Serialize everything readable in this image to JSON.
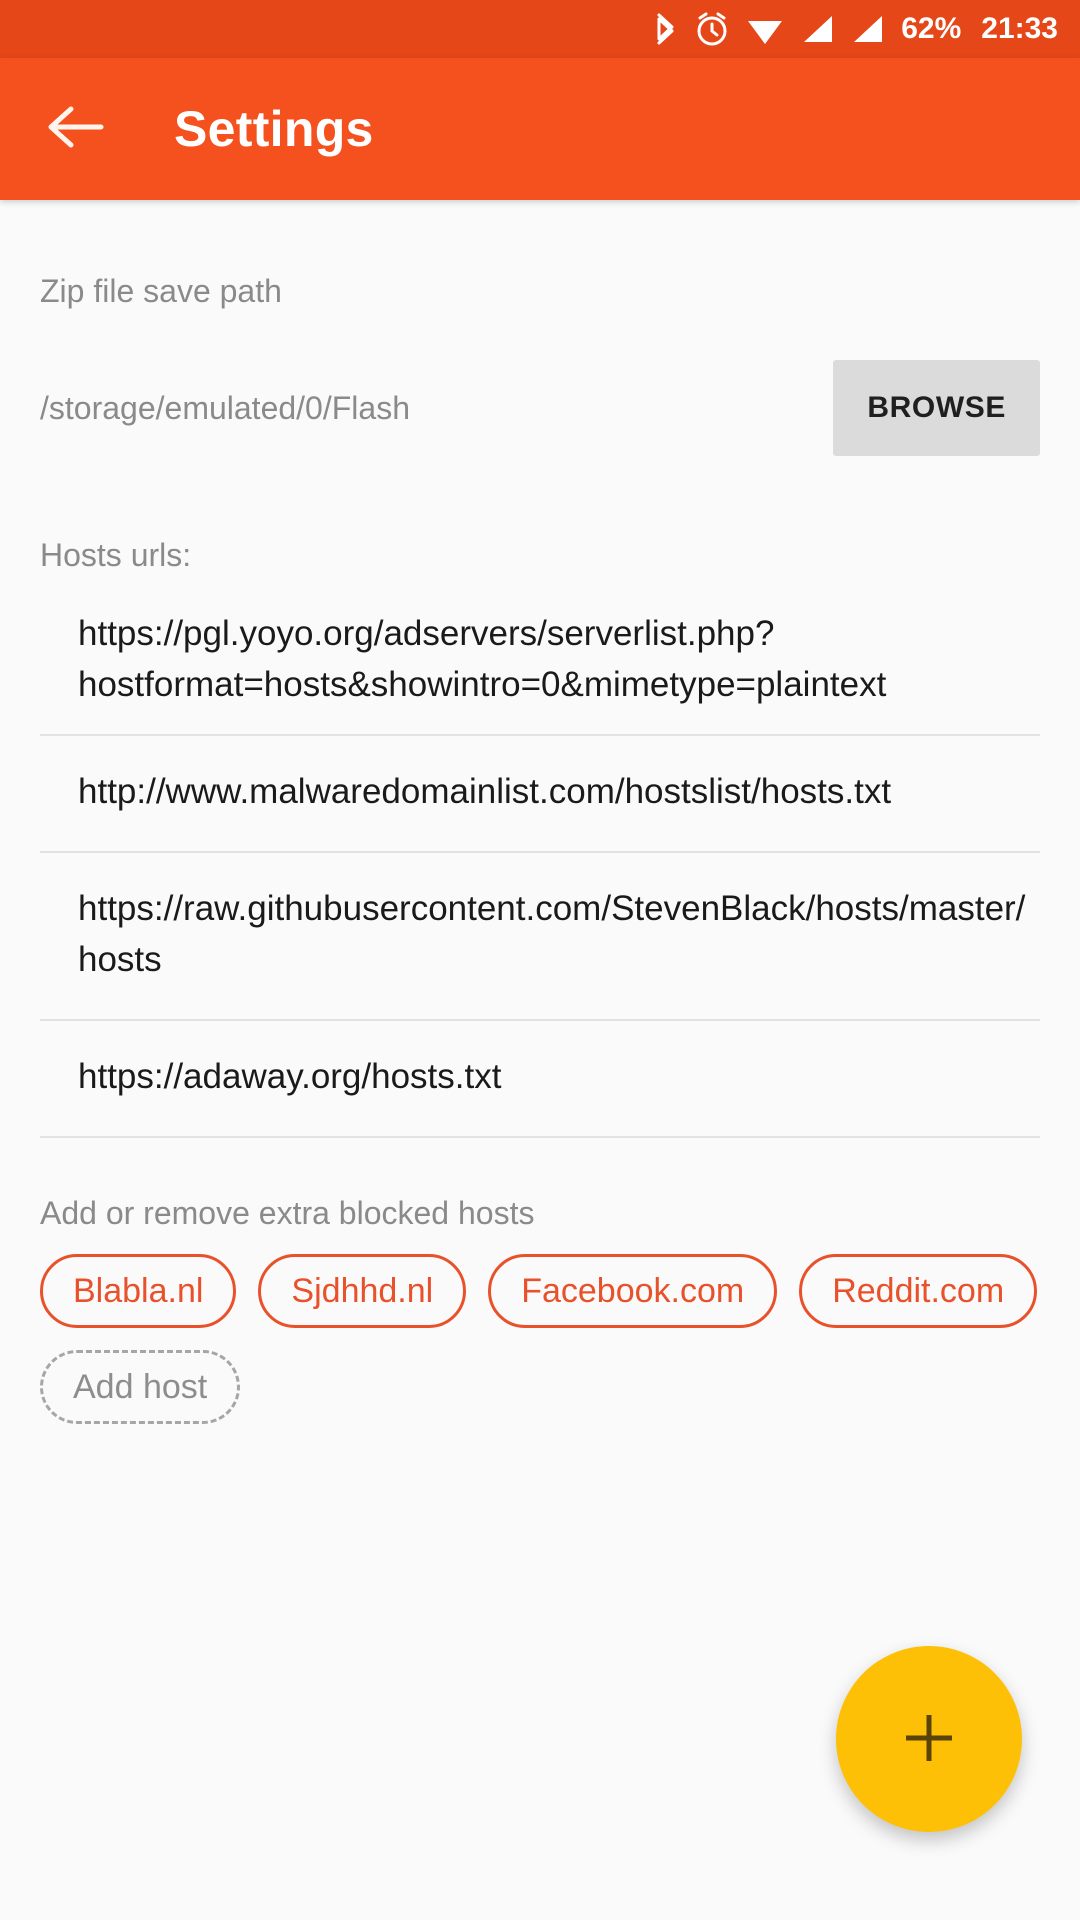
{
  "status_bar": {
    "background": "#E54718",
    "icons": [
      "bluetooth-icon",
      "alarm-icon",
      "wifi-icon",
      "signal-icon",
      "signal-icon"
    ],
    "battery": "62%",
    "time": "21:33"
  },
  "app_bar": {
    "background": "#F4511E",
    "back_icon": "back-arrow-icon",
    "title": "Settings"
  },
  "zip_section": {
    "label": "Zip file save path",
    "path": "/storage/emulated/0/Flash",
    "browse_label": "BROWSE"
  },
  "hosts_section": {
    "label": "Hosts urls:",
    "urls": [
      "https://pgl.yoyo.org/adservers/serverlist.php?hostformat=hosts&showintro=0&mimetype=plaintext",
      "http://www.malwaredomainlist.com/hostslist/hosts.txt",
      "https://raw.githubusercontent.com/StevenBlack/hosts/master/hosts",
      "https://adaway.org/hosts.txt"
    ]
  },
  "blocked_section": {
    "label": "Add or remove extra blocked hosts",
    "chips": [
      "Blabla.nl",
      "Sjdhhd.nl",
      "Facebook.com",
      "Reddit.com"
    ],
    "add_chip_label": "Add host",
    "chip_color": "#E8512A"
  },
  "fab": {
    "icon": "plus-icon",
    "color": "#FDC007"
  }
}
